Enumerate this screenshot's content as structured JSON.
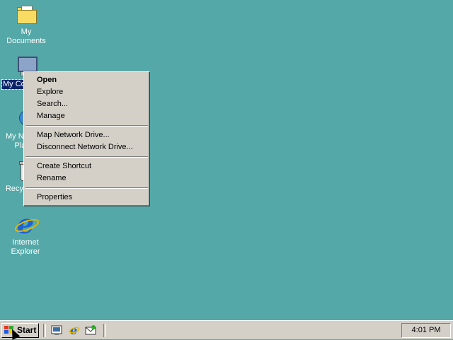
{
  "desktop": {
    "background": "#55a8a8",
    "icons": [
      {
        "label": "My Documents",
        "icon": "folder-icon"
      },
      {
        "label": "My Computer",
        "icon": "computer-icon",
        "selected": true
      },
      {
        "label": "My Network Places",
        "icon": "network-icon"
      },
      {
        "label": "Recycle Bin",
        "icon": "recycle-bin-icon"
      },
      {
        "label": "Internet Explorer",
        "icon": "internet-explorer-icon"
      }
    ]
  },
  "context_menu": {
    "groups": [
      [
        "Open",
        "Explore",
        "Search...",
        "Manage"
      ],
      [
        "Map Network Drive...",
        "Disconnect Network Drive..."
      ],
      [
        "Create Shortcut",
        "Rename"
      ],
      [
        "Properties"
      ]
    ],
    "default_item": "Open"
  },
  "taskbar": {
    "start_label": "Start",
    "quick_launch": [
      "show-desktop-icon",
      "internet-explorer-icon",
      "outlook-express-icon"
    ],
    "clock": "4:01 PM"
  }
}
